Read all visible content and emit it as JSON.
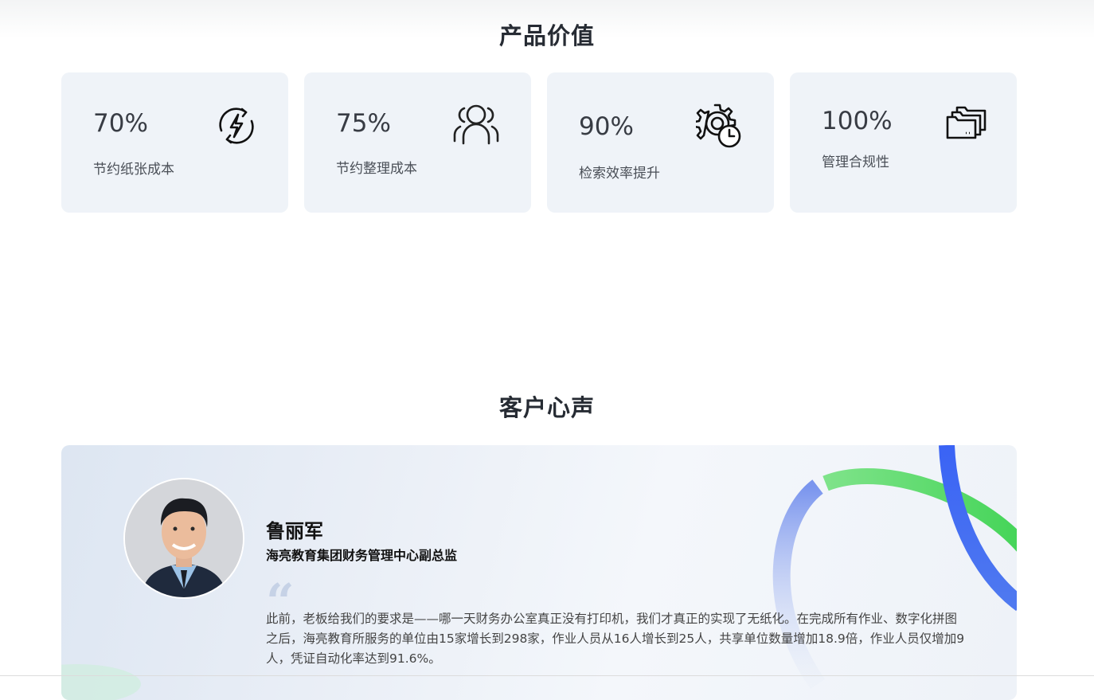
{
  "sections": {
    "product_value_title": "产品价值",
    "customer_voice_title": "客户心声"
  },
  "cards": [
    {
      "percent": "70%",
      "label": "节约纸张成本",
      "icon": "energy-cycle-icon"
    },
    {
      "percent": "75%",
      "label": "节约整理成本",
      "icon": "people-group-icon"
    },
    {
      "percent": "90%",
      "label": "检索效率提升",
      "icon": "gear-clock-icon"
    },
    {
      "percent": "100%",
      "label": "管理合规性",
      "icon": "folders-icon"
    }
  ],
  "testimonial": {
    "name": "鲁丽军",
    "title": "海亮教育集团财务管理中心副总监",
    "quote": "此前，老板给我们的要求是——哪一天财务办公室真正没有打印机，我们才真正的实现了无纸化。在完成所有作业、数字化拼图之后，海亮教育所服务的单位由15家增长到298家，作业人员从16人增长到25人，共享单位数量增加18.9倍，作业人员仅增加9人，凭证自动化率达到91.6%。",
    "quote_open_mark": "“",
    "accent_colors": {
      "green": "#4cd964",
      "blue": "#3a63f5"
    }
  }
}
